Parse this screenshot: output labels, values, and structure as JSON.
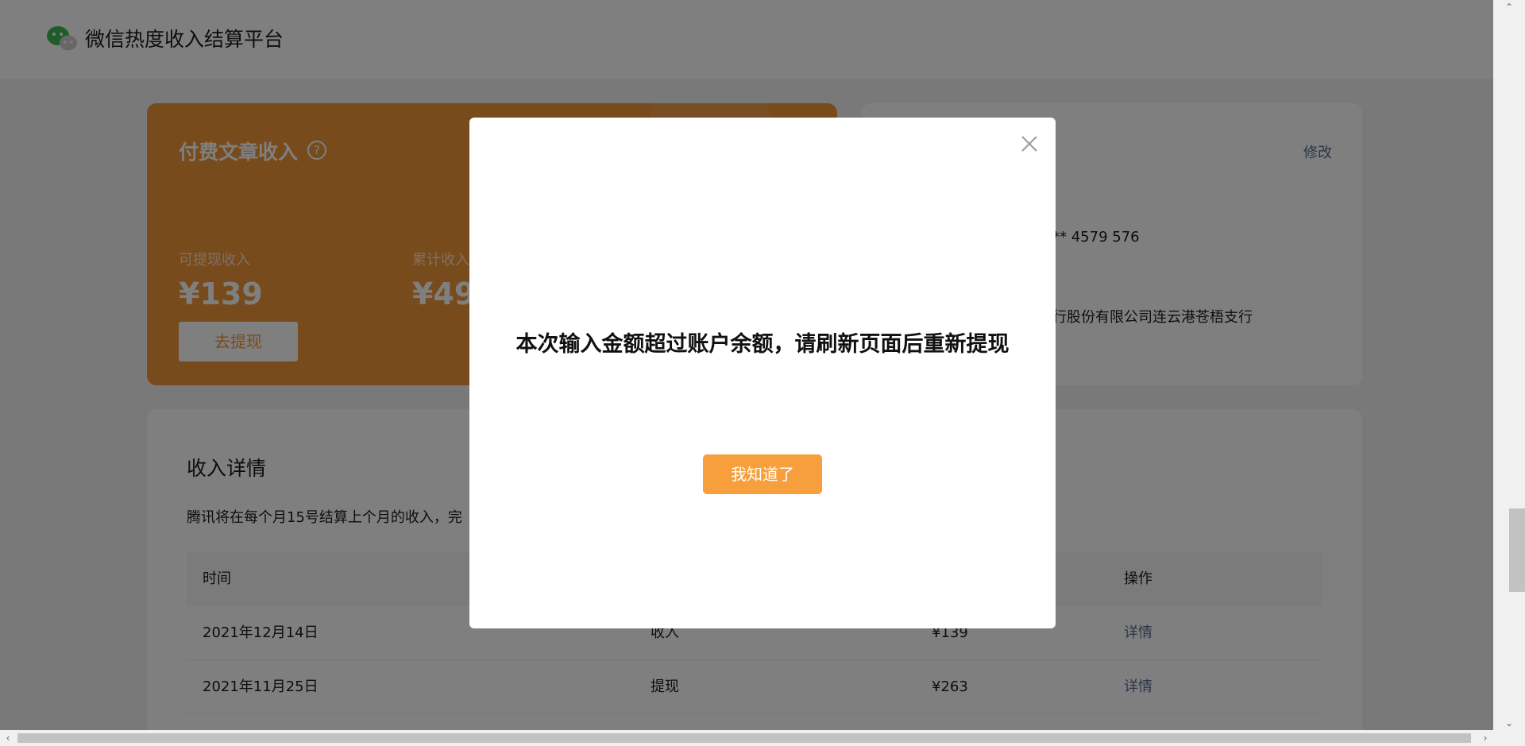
{
  "header": {
    "title": "微信热度收入结算平台",
    "logo_icon": "wechat-logo-icon"
  },
  "income_card": {
    "title": "付费文章收入",
    "help_icon": "question-circle-icon",
    "withdrawable_label": "可提现收入",
    "withdrawable_value": "¥139",
    "cumulative_label": "累计收入",
    "cumulative_value": "¥49",
    "withdraw_button": "去提现",
    "accent_color": "#f0973a"
  },
  "account_card": {
    "modify_link": "修改",
    "account_number": "** 4579 576",
    "bank_name": "行股份有限公司连云港苍梧支行"
  },
  "detail": {
    "title": "收入详情",
    "description": "腾讯将在每个月15号结算上个月的收入，完",
    "columns": [
      "时间",
      "",
      "",
      "操作"
    ],
    "rows": [
      {
        "date": "2021年12月14日",
        "type": "收入",
        "amount": "¥139",
        "action": "详情"
      },
      {
        "date": "2021年11月25日",
        "type": "提现",
        "amount": "¥263",
        "action": "详情"
      }
    ]
  },
  "modal": {
    "message": "本次输入金额超过账户余额，请刷新页面后重新提现",
    "confirm_button": "我知道了",
    "close_icon": "close-icon",
    "button_color": "#f79f3c"
  }
}
